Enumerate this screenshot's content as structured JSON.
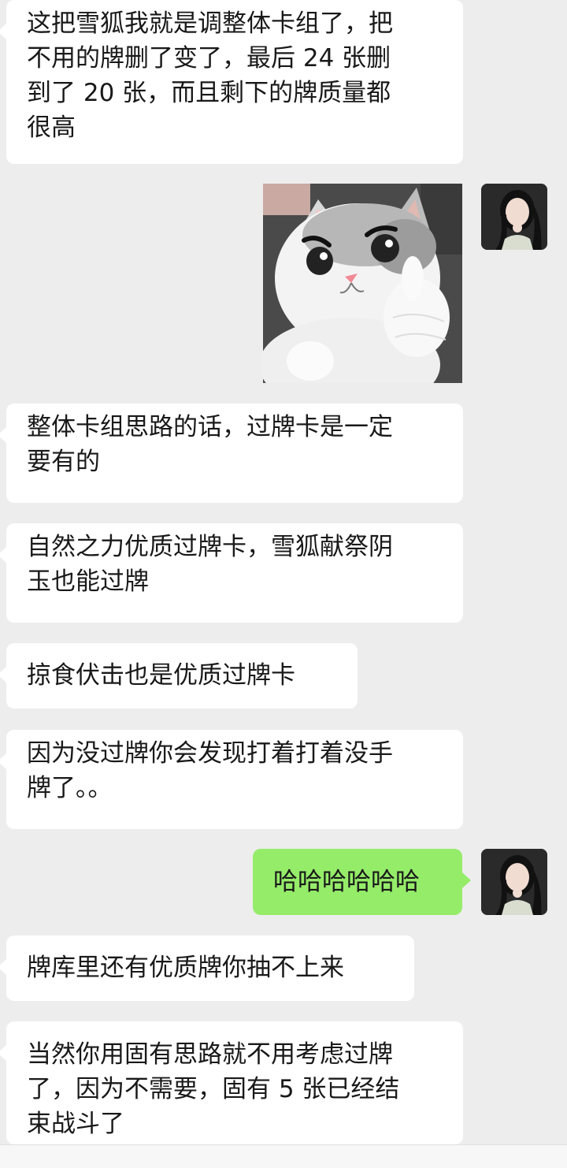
{
  "messages": [
    {
      "text": "这把雪狐我就是调整体卡组了，把\n不用的牌删了变了，最后 24 张删\n到了 20 张，而且剩下的牌质量都\n很高"
    },
    {
      "image": "cat-thumbs-up-sticker"
    },
    {
      "text": "整体卡组思路的话，过牌卡是一定\n要有的"
    },
    {
      "text": "自然之力优质过牌卡，雪狐献祭阴\n玉也能过牌"
    },
    {
      "text": "掠食伏击也是优质过牌卡"
    },
    {
      "text": "因为没过牌你会发现打着打着没手\n牌了。。"
    },
    {
      "text": "哈哈哈哈哈哈"
    },
    {
      "text": "牌库里还有优质牌你抽不上来"
    },
    {
      "text": "当然你用固有思路就不用考虑过牌\n了，因为不需要，固有 5 张已经结\n束战斗了"
    }
  ],
  "colors": {
    "background": "#ededed",
    "incoming": "#ffffff",
    "outgoing": "#95ec69"
  },
  "icons": {
    "avatar": "user-avatar-photo",
    "sticker": "cat-thumbs-up-sticker"
  }
}
